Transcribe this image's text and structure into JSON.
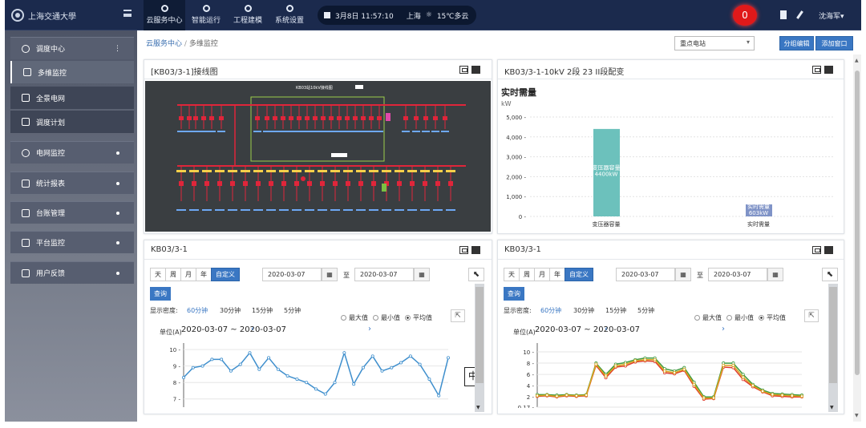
{
  "header": {
    "logo_text": "上海交通大學",
    "nav": [
      {
        "label": "云服务中心",
        "active": true
      },
      {
        "label": "智能运行",
        "active": false
      },
      {
        "label": "工程建模",
        "active": false
      },
      {
        "label": "系统设置",
        "active": false
      }
    ],
    "datetime": "3月8日 11:57:10",
    "city": "上海",
    "weather": "15℃多云",
    "alert_count": "0",
    "user": "沈海军▾"
  },
  "sidebar": {
    "items": [
      {
        "label": "调度中心",
        "type": "group"
      },
      {
        "label": "多维监控",
        "type": "sub",
        "active": true
      },
      {
        "label": "全景电网",
        "type": "sub"
      },
      {
        "label": "调度计划",
        "type": "sub"
      },
      {
        "label": "电网监控",
        "type": "group"
      },
      {
        "label": "统计报表",
        "type": "group"
      },
      {
        "label": "台账管理",
        "type": "group"
      },
      {
        "label": "平台监控",
        "type": "group"
      },
      {
        "label": "用户反馈",
        "type": "group"
      }
    ]
  },
  "breadcrumb": {
    "root": "云服务中心",
    "sep": "/",
    "current": "多维监控"
  },
  "toolbar": {
    "station_select": "重点电站",
    "group_edit": "分组编辑",
    "add_window": "添加窗口"
  },
  "panels": {
    "p1": {
      "title": "[KB03/3-1]接线图",
      "diagram_title": "KB03站10kV接线图"
    },
    "p2": {
      "title": "KB03/3-1-10kV 2段 23 II段配变",
      "chart_title": "实时需量",
      "unit": "kW"
    },
    "p3": {
      "title": "KB03/3-1",
      "date_from": "2020-03-07",
      "date_to": "2020-03-07",
      "to_label": "至",
      "query": "查询",
      "density_label": "显示密度:",
      "range_text": "2020-03-07  ~  2020-03-07",
      "y_unit": "单位(A)"
    },
    "p4": {
      "title": "KB03/3-1",
      "date_from": "2020-03-07",
      "date_to": "2020-03-07",
      "to_label": "至",
      "query": "查询",
      "density_label": "显示密度:",
      "range_text": "2020-03-07  ~  2020-03-07",
      "y_unit": "单位(A)"
    }
  },
  "period_tabs": [
    "天",
    "周",
    "月",
    "年",
    "自定义"
  ],
  "density_options": [
    "60分钟",
    "30分钟",
    "15分钟",
    "5分钟"
  ],
  "stat_options": [
    "最大值",
    "最小值",
    "平均值"
  ],
  "ime_indicator": "中",
  "chart_data": [
    {
      "type": "bar",
      "title": "实时需量",
      "ylabel": "kW",
      "categories": [
        "变压器容量",
        "实时需量"
      ],
      "values": [
        4400,
        603
      ],
      "data_labels": [
        "变压器容量\n4400kW",
        "实时需量\n603kW"
      ],
      "ylim": [
        0,
        5000
      ],
      "yticks": [
        "0",
        "1,000",
        "2,000",
        "3,000",
        "4,000",
        "5,000"
      ],
      "colors": [
        "#6cc1bc",
        "#7f93c7"
      ]
    },
    {
      "type": "line",
      "ylabel": "单位(A)",
      "ylim": [
        6.5,
        10.2
      ],
      "yticks": [
        "7",
        "8",
        "9",
        "10"
      ],
      "series": [
        {
          "color": "#3f8fcd",
          "values": [
            8.3,
            8.9,
            9.0,
            9.4,
            9.4,
            8.7,
            9.1,
            9.8,
            8.8,
            9.5,
            8.8,
            8.4,
            8.2,
            8.0,
            7.6,
            7.3,
            8.0,
            9.8,
            7.9,
            8.9,
            9.6,
            8.7,
            8.9,
            9.2,
            9.6,
            9.1,
            8.2,
            7.2,
            9.5
          ]
        }
      ]
    },
    {
      "type": "line",
      "ylabel": "单位(A)",
      "ylim": [
        0.17,
        11
      ],
      "yticks": [
        "0.17",
        "2",
        "4",
        "6",
        "8",
        "10"
      ],
      "series": [
        {
          "color": "#3f9a3f",
          "values": [
            2.4,
            2.4,
            2.3,
            2.4,
            2.3,
            2.4,
            8.0,
            6.0,
            7.8,
            8.1,
            8.6,
            8.9,
            8.9,
            7.0,
            6.6,
            7.2,
            4.6,
            2.0,
            2.0,
            8.0,
            8.0,
            6.0,
            4.2,
            3.2,
            2.6,
            2.5,
            2.4,
            2.3
          ]
        },
        {
          "color": "#e03a2a",
          "values": [
            2.1,
            2.2,
            2.0,
            2.2,
            2.1,
            2.2,
            7.6,
            5.4,
            7.3,
            7.5,
            8.2,
            8.4,
            8.3,
            6.3,
            6.1,
            6.7,
            3.9,
            1.6,
            1.7,
            7.3,
            7.2,
            5.1,
            3.8,
            2.9,
            2.2,
            2.1,
            2.0,
            2.0
          ]
        },
        {
          "color": "#d9a520",
          "values": [
            2.2,
            2.3,
            2.1,
            2.3,
            2.2,
            2.3,
            7.8,
            5.7,
            7.5,
            7.8,
            8.4,
            8.6,
            8.6,
            6.6,
            6.3,
            6.9,
            4.2,
            1.8,
            1.8,
            7.6,
            7.6,
            5.5,
            4.0,
            3.0,
            2.4,
            2.3,
            2.2,
            2.1
          ]
        }
      ]
    }
  ]
}
